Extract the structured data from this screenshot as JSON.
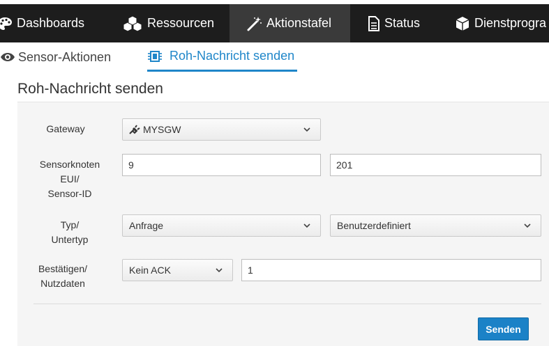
{
  "nav": {
    "items": [
      {
        "label": "Dashboards",
        "icon": "palette-icon"
      },
      {
        "label": "Ressourcen",
        "icon": "cubes-icon"
      },
      {
        "label": "Aktionstafel",
        "icon": "magic-wand-icon"
      },
      {
        "label": "Status",
        "icon": "document-icon"
      },
      {
        "label": "Dienstprogra",
        "icon": "cube-icon"
      }
    ],
    "active_index": 2
  },
  "tabs": {
    "sensor_actions": "Sensor-Aktionen",
    "send_raw": "Roh-Nachricht senden"
  },
  "page": {
    "title": "Roh-Nachricht senden"
  },
  "form": {
    "gateway": {
      "label": "Gateway",
      "value": "MYSGW"
    },
    "node": {
      "label_line1": "Sensorknoten",
      "label_line2": "EUI/",
      "label_line3": "Sensor-ID",
      "node_value": "9",
      "sensor_value": "201"
    },
    "type": {
      "label_line1": "Typ/",
      "label_line2": "Untertyp",
      "type_value": "Anfrage",
      "subtype_value": "Benutzerdefiniert"
    },
    "ack": {
      "label_line1": "Bestätigen/",
      "label_line2": "Nutzdaten",
      "ack_value": "Kein ACK",
      "payload_value": "1"
    },
    "submit_label": "Senden"
  },
  "colors": {
    "accent": "#1f86c9",
    "navbar": "#1d1d1d",
    "button": "#1b82c7"
  }
}
